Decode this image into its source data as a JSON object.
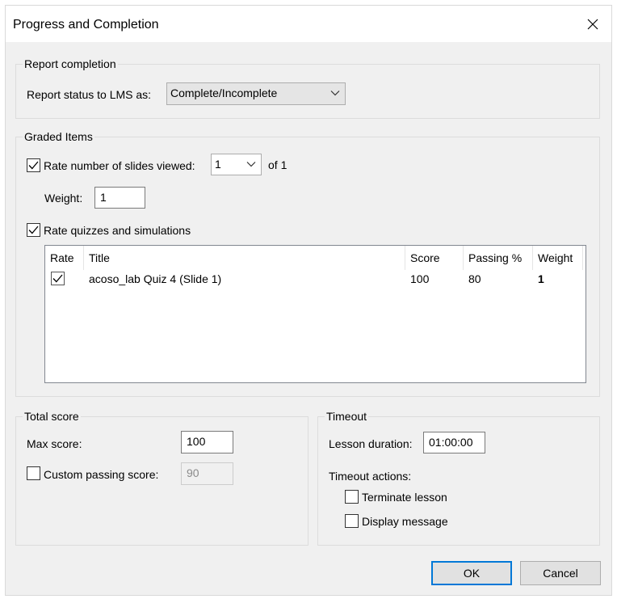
{
  "window": {
    "title": "Progress and Completion"
  },
  "report_completion": {
    "legend": "Report completion",
    "label": "Report status to LMS as:",
    "selected": "Complete/Incomplete"
  },
  "graded_items": {
    "legend": "Graded Items",
    "rate_slides": {
      "label": "Rate number of slides viewed:",
      "checked": true,
      "selected": "1",
      "suffix": "of 1"
    },
    "weight": {
      "label": "Weight:",
      "value": "1"
    },
    "rate_quizzes": {
      "label": "Rate quizzes and simulations",
      "checked": true
    },
    "table": {
      "columns": [
        "Rate",
        "Title",
        "Score",
        "Passing %",
        "Weight"
      ],
      "rows": [
        {
          "rate": true,
          "title": "acoso_lab Quiz 4 (Slide 1)",
          "score": "100",
          "passing": "80",
          "weight": "1"
        }
      ]
    }
  },
  "total_score": {
    "legend": "Total score",
    "max_label": "Max score:",
    "max_value": "100",
    "custom_label": "Custom passing score:",
    "custom_checked": false,
    "custom_value": "90"
  },
  "timeout": {
    "legend": "Timeout",
    "duration_label": "Lesson duration:",
    "duration_value": "01:00:00",
    "actions_label": "Timeout actions:",
    "terminate_label": "Terminate lesson",
    "terminate_checked": false,
    "display_label": "Display message",
    "display_checked": false
  },
  "buttons": {
    "ok": "OK",
    "cancel": "Cancel"
  },
  "colors": {
    "dialog_bg": "#f0f0f0",
    "focus_border": "#0078d7"
  }
}
